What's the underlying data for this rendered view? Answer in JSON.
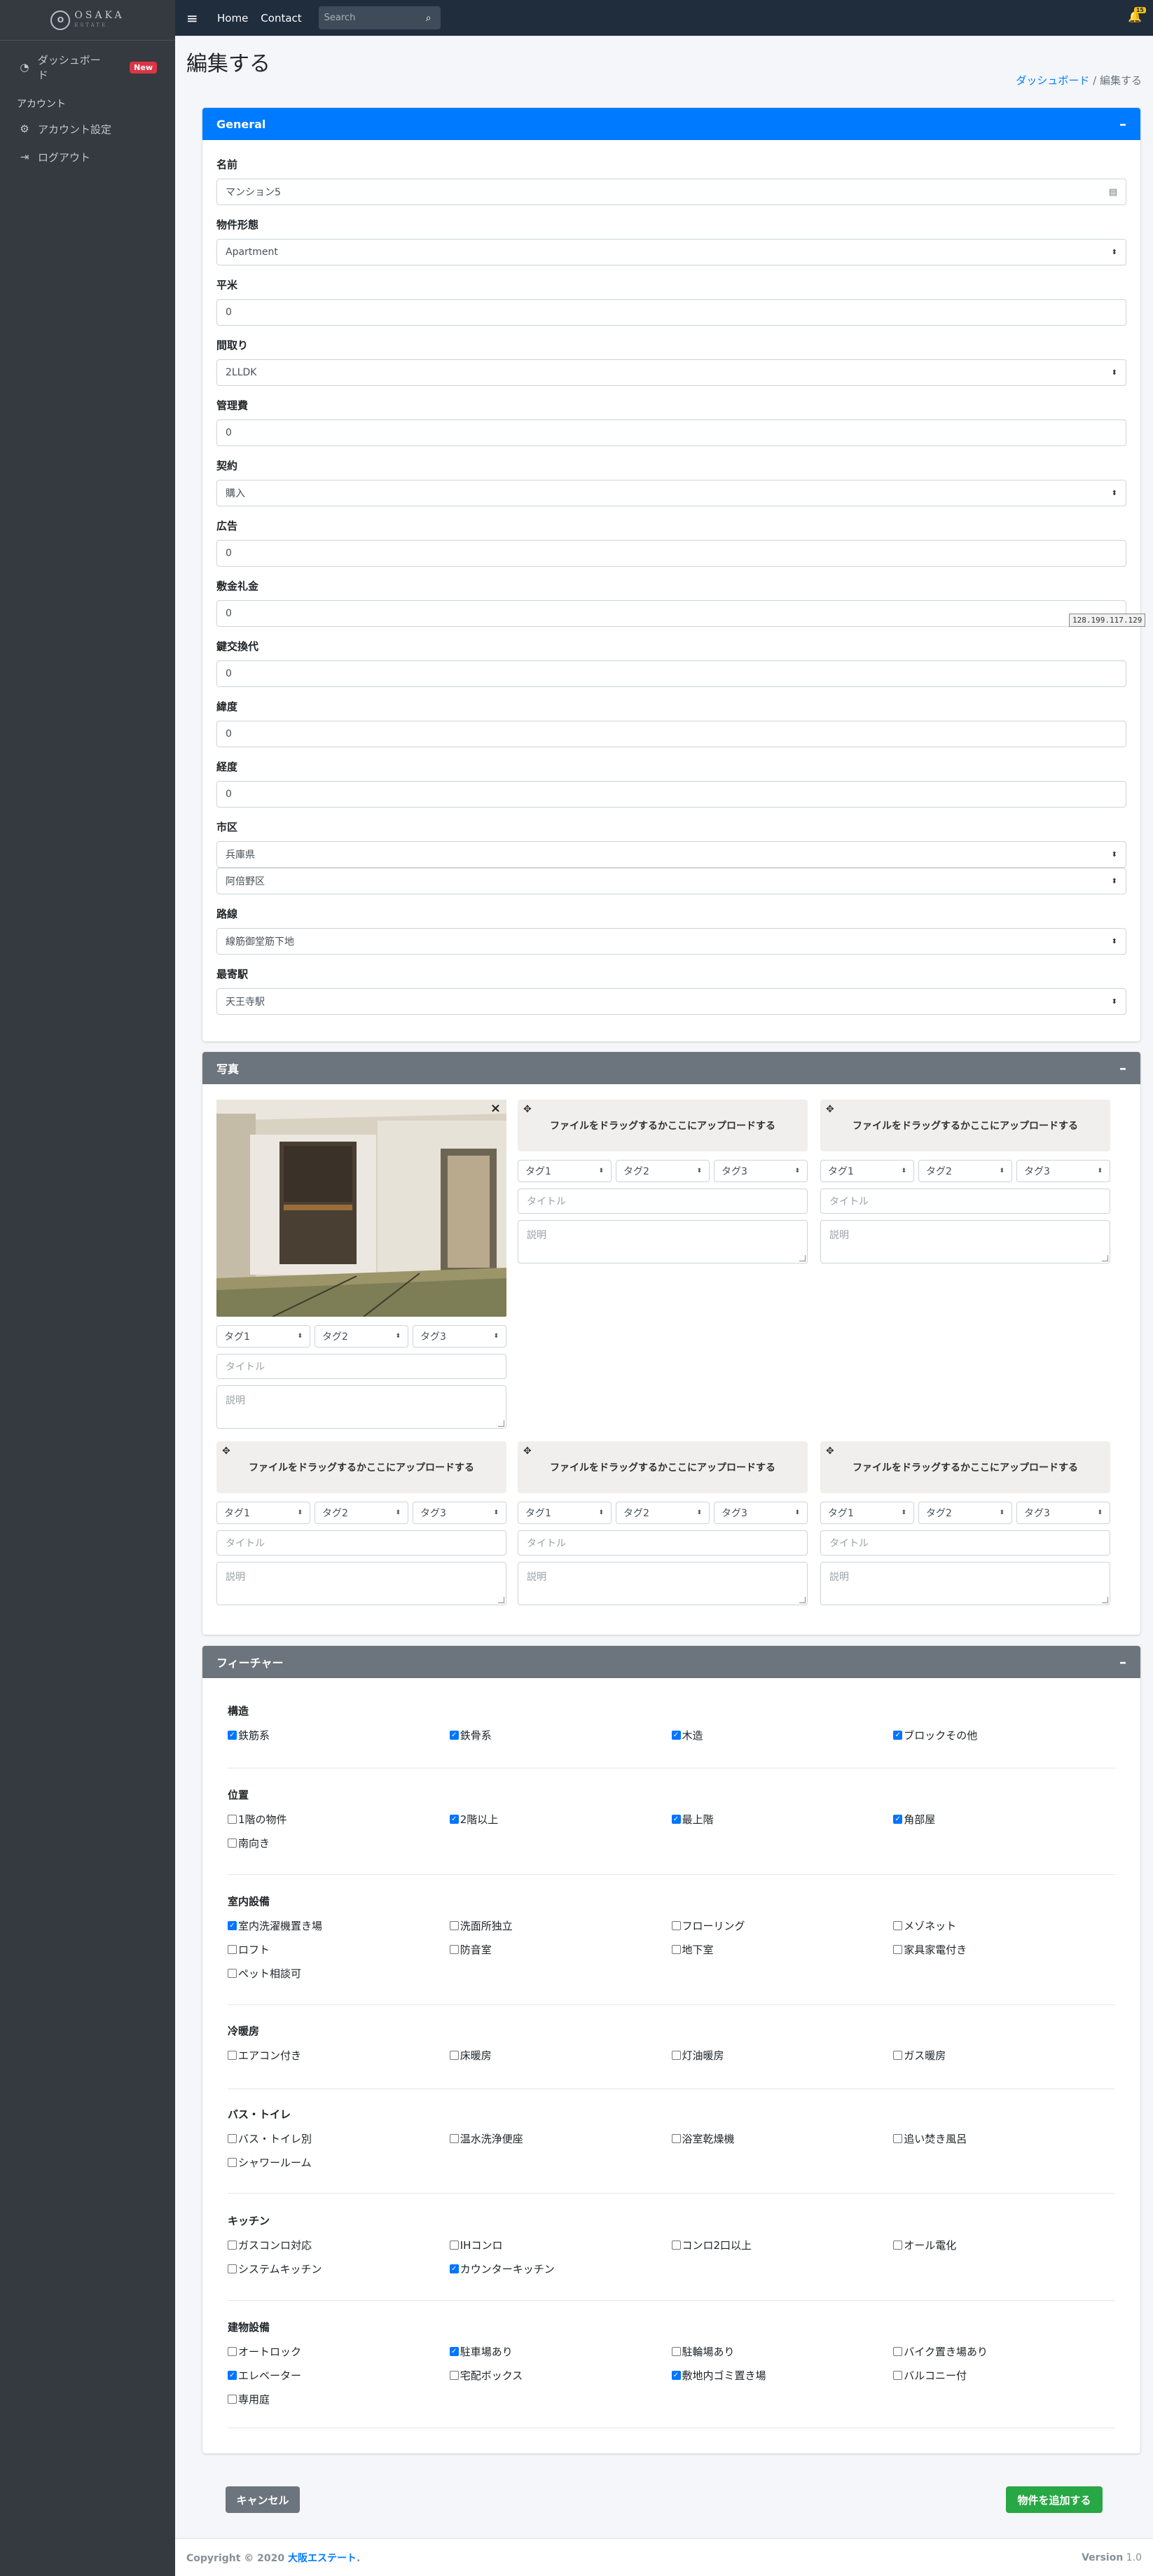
{
  "brand": {
    "name": "OSAKA",
    "sub": "ESTATE",
    "mark": "O"
  },
  "sidebar": {
    "dashboard": "ダッシュボード",
    "badge": "New",
    "account_header": "アカウント",
    "account_settings": "アカウント設定",
    "logout": "ログアウト"
  },
  "topbar": {
    "home": "Home",
    "contact": "Contact",
    "search_placeholder": "Search",
    "bell_count": "15"
  },
  "page": {
    "title": "編集する",
    "crumb_home": "ダッシュボード",
    "crumb_current": "編集する"
  },
  "general": {
    "title": "General",
    "toggle": "–",
    "fields": {
      "name": {
        "label": "名前",
        "value": "マンション5"
      },
      "type": {
        "label": "物件形態",
        "value": "Apartment"
      },
      "area": {
        "label": "平米",
        "value": "0"
      },
      "layout": {
        "label": "間取り",
        "value": "2LLDK"
      },
      "mgmt": {
        "label": "管理費",
        "value": "0"
      },
      "contract": {
        "label": "契約",
        "value": "購入"
      },
      "ad": {
        "label": "広告",
        "value": "0"
      },
      "deposit": {
        "label": "敷金礼金",
        "value": "0"
      },
      "key": {
        "label": "鍵交換代",
        "value": "0"
      },
      "lat": {
        "label": "緯度",
        "value": "0"
      },
      "lng": {
        "label": "経度",
        "value": "0"
      },
      "city": {
        "label": "市区",
        "pref": "兵庫県",
        "ward": "阿倍野区"
      },
      "line": {
        "label": "路線",
        "value": "線筋御堂筋下地"
      },
      "station": {
        "label": "最寄駅",
        "value": "天王寺駅"
      }
    },
    "ip_tooltip": "128.199.117.129"
  },
  "photos": {
    "title": "写真",
    "toggle": "–",
    "drop_text": "ファイルをドラッグするかここにアップロードする",
    "tag1": "タグ1",
    "tag2": "タグ2",
    "tag3": "タグ3",
    "title_ph": "タイトル",
    "desc_ph": "説明",
    "close": "×",
    "move": "✥"
  },
  "features": {
    "title": "フィーチャー",
    "toggle": "–",
    "groups": [
      {
        "name": "構造",
        "items": [
          [
            "鉄筋系",
            true
          ],
          [
            "鉄骨系",
            true
          ],
          [
            "木造",
            true
          ],
          [
            "ブロックその他",
            true
          ]
        ]
      },
      {
        "name": "位置",
        "items": [
          [
            "1階の物件",
            false
          ],
          [
            "2階以上",
            true
          ],
          [
            "最上階",
            true
          ],
          [
            "角部屋",
            true
          ],
          [
            "南向き",
            false
          ]
        ]
      },
      {
        "name": "室内設備",
        "items": [
          [
            "室内洗濯機置き場",
            true
          ],
          [
            "洗面所独立",
            false
          ],
          [
            "フローリング",
            false
          ],
          [
            "メゾネット",
            false
          ],
          [
            "ロフト",
            false
          ],
          [
            "防音室",
            false
          ],
          [
            "地下室",
            false
          ],
          [
            "家具家電付き",
            false
          ],
          [
            "ペット相談可",
            false
          ]
        ]
      },
      {
        "name": "冷暖房",
        "items": [
          [
            "エアコン付き",
            false
          ],
          [
            "床暖房",
            false
          ],
          [
            "灯油暖房",
            false
          ],
          [
            "ガス暖房",
            false
          ]
        ]
      },
      {
        "name": "バス・トイレ",
        "items": [
          [
            "バス・トイレ別",
            false
          ],
          [
            "温水洗浄便座",
            false
          ],
          [
            "浴室乾燥機",
            false
          ],
          [
            "追い焚き風呂",
            false
          ],
          [
            "シャワールーム",
            false
          ]
        ]
      },
      {
        "name": "キッチン",
        "items": [
          [
            "ガスコンロ対応",
            false
          ],
          [
            "IHコンロ",
            false
          ],
          [
            "コンロ2口以上",
            false
          ],
          [
            "オール電化",
            false
          ],
          [
            "システムキッチン",
            false
          ],
          [
            "カウンターキッチン",
            true
          ]
        ]
      },
      {
        "name": "建物設備",
        "items": [
          [
            "オートロック",
            false
          ],
          [
            "駐車場あり",
            true
          ],
          [
            "駐輪場あり",
            false
          ],
          [
            "バイク置き場あり",
            false
          ],
          [
            "エレベーター",
            true
          ],
          [
            "宅配ボックス",
            false
          ],
          [
            "敷地内ゴミ置き場",
            true
          ],
          [
            "バルコニー付",
            false
          ],
          [
            "専用庭",
            false
          ]
        ]
      }
    ]
  },
  "actions": {
    "cancel": "キャンセル",
    "submit": "物件を追加する"
  },
  "footer": {
    "copy": "Copyright © 2020",
    "company": "大阪エステート",
    "dot": ".",
    "version_label": "Version",
    "version": "1.0"
  },
  "colors": {
    "primary": "#007bff",
    "success": "#28a745",
    "secondary": "#6c757d",
    "sidebar": "#343a40",
    "topbar": "#1f2d3d"
  }
}
